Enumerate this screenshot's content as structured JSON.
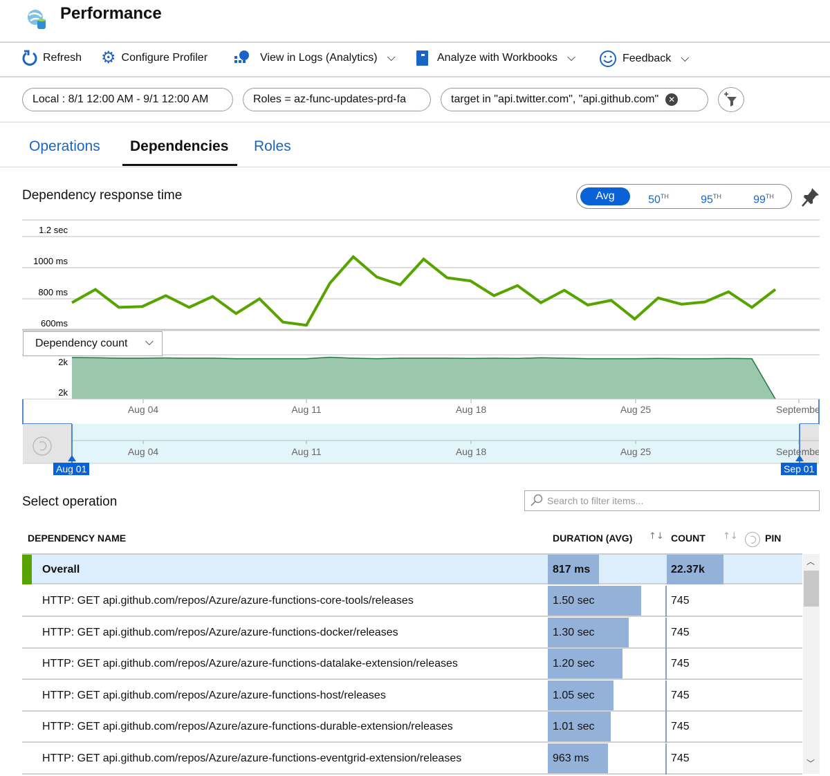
{
  "header": {
    "title": "Performance",
    "icon": "app-insights-globe-icon"
  },
  "toolbar": {
    "refresh": "Refresh",
    "configure_profiler": "Configure Profiler",
    "view_in_logs": "View in Logs (Analytics)",
    "analyze_workbooks": "Analyze with Workbooks",
    "feedback": "Feedback"
  },
  "filters": {
    "time": "Local : 8/1 12:00 AM - 9/1 12:00 AM",
    "roles": "Roles = az-func-updates-prd-fa",
    "target": "target in \"api.twitter.com\", \"api.github.com\""
  },
  "tabs": [
    {
      "label": "Operations"
    },
    {
      "label": "Dependencies",
      "active": true
    },
    {
      "label": "Roles"
    }
  ],
  "chart_section": {
    "title": "Dependency response time",
    "segments": [
      {
        "label": "Avg",
        "selected": true
      },
      {
        "label": "50",
        "sup": "TH"
      },
      {
        "label": "95",
        "sup": "TH"
      },
      {
        "label": "99",
        "sup": "TH"
      }
    ],
    "metric_dropdown": "Dependency count"
  },
  "chart_data": [
    {
      "type": "line",
      "color": "#57a300",
      "ytick_labels": [
        "1.2 sec",
        "1000 ms",
        "800 ms",
        "600ms"
      ],
      "ylim": [
        600,
        1200
      ],
      "grid": true,
      "x": [
        "Aug 01",
        "Aug 02",
        "Aug 03",
        "Aug 04",
        "Aug 05",
        "Aug 06",
        "Aug 07",
        "Aug 08",
        "Aug 09",
        "Aug 10",
        "Aug 11",
        "Aug 12",
        "Aug 13",
        "Aug 14",
        "Aug 15",
        "Aug 16",
        "Aug 17",
        "Aug 18",
        "Aug 19",
        "Aug 20",
        "Aug 21",
        "Aug 22",
        "Aug 23",
        "Aug 24",
        "Aug 25",
        "Aug 26",
        "Aug 27",
        "Aug 28",
        "Aug 29",
        "Aug 30",
        "Aug 31"
      ],
      "values": [
        775,
        860,
        745,
        750,
        820,
        745,
        815,
        705,
        800,
        650,
        630,
        900,
        1070,
        940,
        890,
        1055,
        935,
        915,
        820,
        885,
        775,
        855,
        760,
        790,
        670,
        805,
        765,
        780,
        845,
        745,
        860
      ]
    },
    {
      "type": "area",
      "color": "#9bc7ad",
      "line_color": "#1e7a46",
      "ytick_labels": [
        "2k",
        "2k"
      ],
      "ylim": [
        1900,
        2070
      ],
      "values": [
        2065,
        2064,
        2062,
        2062,
        2063,
        2062,
        2062,
        2060,
        2060,
        2060,
        2060,
        2066,
        2062,
        2060,
        2062,
        2062,
        2062,
        2061,
        2062,
        2061,
        2064,
        2062,
        2060,
        2060,
        2060,
        2061,
        2060,
        2060,
        2061,
        2060,
        1900
      ]
    },
    {
      "type": "time-axis",
      "xtick_labels": [
        "Aug 04",
        "Aug 11",
        "Aug 18",
        "Aug 25",
        "September"
      ],
      "range_start": "Aug 01",
      "range_end": "Sep 01"
    }
  ],
  "operations": {
    "title": "Select operation",
    "search_placeholder": "Search to filter items...",
    "columns": {
      "name": "DEPENDENCY NAME",
      "duration": "DURATION (AVG)",
      "count": "COUNT",
      "pin": "PIN"
    },
    "overall": {
      "name": "Overall",
      "duration": "817 ms",
      "duration_ms": 817,
      "count": "22.37k"
    },
    "rows": [
      {
        "name": "HTTP: GET api.github.com/repos/Azure/azure-functions-core-tools/releases",
        "duration": "1.50 sec",
        "duration_ms": 1500,
        "count": "745"
      },
      {
        "name": "HTTP: GET api.github.com/repos/Azure/azure-functions-docker/releases",
        "duration": "1.30 sec",
        "duration_ms": 1300,
        "count": "745"
      },
      {
        "name": "HTTP: GET api.github.com/repos/Azure/azure-functions-datalake-extension/releases",
        "duration": "1.20 sec",
        "duration_ms": 1200,
        "count": "745"
      },
      {
        "name": "HTTP: GET api.github.com/repos/Azure/azure-functions-host/releases",
        "duration": "1.05 sec",
        "duration_ms": 1050,
        "count": "745"
      },
      {
        "name": "HTTP: GET api.github.com/repos/Azure/azure-functions-durable-extension/releases",
        "duration": "1.01 sec",
        "duration_ms": 1010,
        "count": "745"
      },
      {
        "name": "HTTP: GET api.github.com/repos/Azure/azure-functions-eventgrid-extension/releases",
        "duration": "963 ms",
        "duration_ms": 963,
        "count": "745"
      }
    ]
  }
}
